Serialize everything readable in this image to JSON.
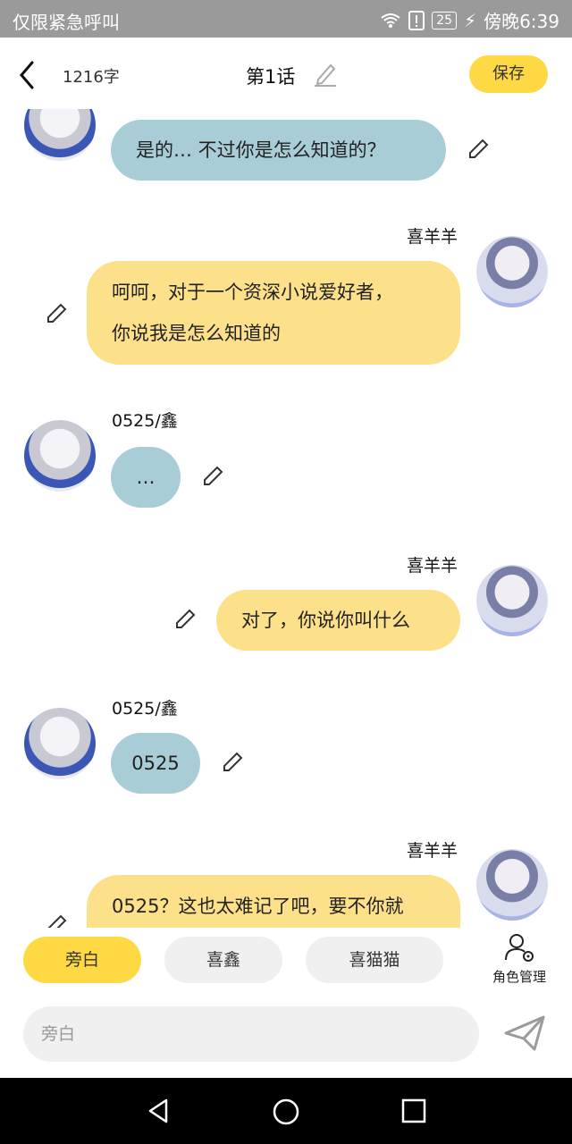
{
  "status_bar": {
    "left_text": "仅限紧急呼叫",
    "battery_level": "25",
    "time_label": "傍晚6:39"
  },
  "header": {
    "word_count": "1216字",
    "chapter_title": "第1话",
    "save_label": "保存"
  },
  "messages": [
    {
      "side": "left",
      "name": "",
      "lines": [
        "是的… 不过你是怎么知道的？"
      ]
    },
    {
      "side": "right",
      "name": "喜羊羊",
      "lines": [
        "呵呵，对于一个资深小说爱好者，",
        "你说我是怎么知道的"
      ]
    },
    {
      "side": "left",
      "name": "0525/鑫",
      "lines": [
        "…"
      ]
    },
    {
      "side": "right",
      "name": "喜羊羊",
      "lines": [
        "对了，你说你叫什么"
      ]
    },
    {
      "side": "left",
      "name": "0525/鑫",
      "lines": [
        "0525"
      ]
    },
    {
      "side": "right",
      "name": "喜羊羊",
      "lines": [
        "0525？这也太难记了吧，要不你就"
      ]
    }
  ],
  "roles": {
    "items": [
      "旁白",
      "喜鑫",
      "喜猫猫"
    ],
    "manage_label": "角色管理"
  },
  "input": {
    "placeholder": "旁白"
  },
  "colors": {
    "accent_yellow": "#ffd943",
    "left_bubble": "#a9cdd6",
    "right_bubble": "#fde08a"
  }
}
